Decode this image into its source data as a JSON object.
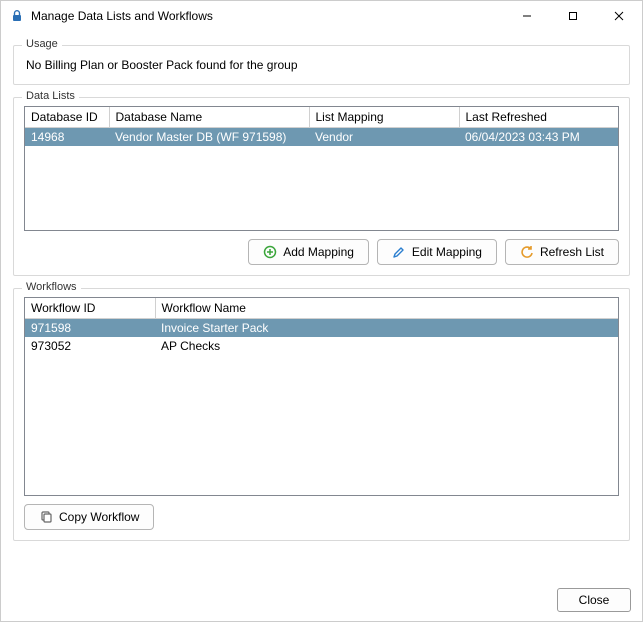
{
  "window": {
    "title": "Manage Data Lists and Workflows"
  },
  "usage": {
    "legend": "Usage",
    "text": "No Billing Plan or Booster Pack found for the group"
  },
  "dataLists": {
    "legend": "Data Lists",
    "columns": {
      "dbId": "Database ID",
      "dbName": "Database Name",
      "mapping": "List Mapping",
      "refreshed": "Last Refreshed"
    },
    "rows": [
      {
        "dbId": "14968",
        "dbName": "Vendor Master DB (WF 971598)",
        "mapping": "Vendor",
        "refreshed": "06/04/2023 03:43 PM",
        "selected": true
      }
    ],
    "buttons": {
      "add": "Add Mapping",
      "edit": "Edit Mapping",
      "refresh": "Refresh List"
    }
  },
  "workflows": {
    "legend": "Workflows",
    "columns": {
      "wfId": "Workflow ID",
      "wfName": "Workflow Name"
    },
    "rows": [
      {
        "wfId": "971598",
        "wfName": "Invoice Starter Pack",
        "selected": true
      },
      {
        "wfId": "973052",
        "wfName": "AP Checks",
        "selected": false
      }
    ],
    "buttons": {
      "copy": "Copy Workflow"
    }
  },
  "footer": {
    "close": "Close"
  }
}
